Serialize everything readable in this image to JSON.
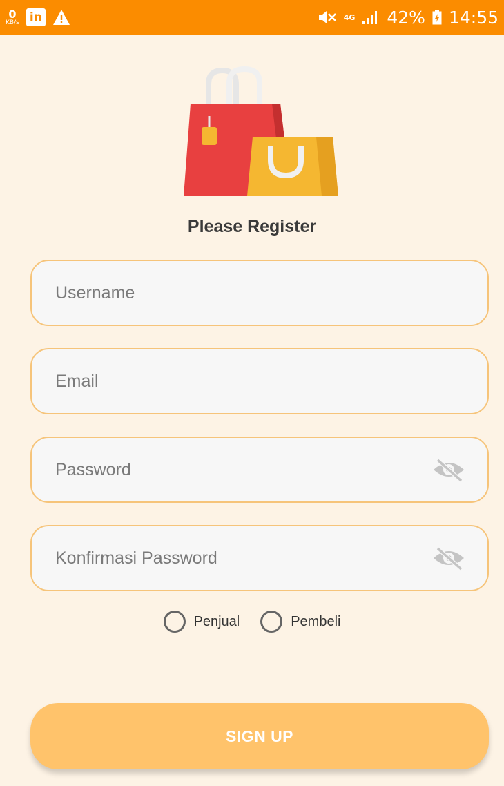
{
  "status_bar": {
    "speed_value": "0",
    "speed_unit": "KB/s",
    "linkedin_badge": "in",
    "network_type": "4G",
    "battery_percent": "42%",
    "time": "14:55",
    "icons": [
      "linkedin-icon",
      "warning-icon",
      "mute-icon",
      "signal-icon",
      "battery-icon"
    ]
  },
  "logo": {
    "icon": "shopping-bags-icon",
    "colors": {
      "red_bag": "#e84040",
      "yellow_bag": "#f5b731",
      "handle": "#f0f0f0"
    }
  },
  "title": "Please Register",
  "fields": {
    "username": {
      "placeholder": "Username",
      "value": ""
    },
    "email": {
      "placeholder": "Email",
      "value": ""
    },
    "password": {
      "placeholder": "Password",
      "value": ""
    },
    "confirm_password": {
      "placeholder": "Konfirmasi Password",
      "value": ""
    }
  },
  "role_options": [
    {
      "label": "Penjual",
      "selected": false
    },
    {
      "label": "Pembeli",
      "selected": false
    }
  ],
  "signup_label": "SIGN UP",
  "colors": {
    "status_bar": "#fb8c00",
    "background": "#fdf3e5",
    "field_border": "#f6c47a",
    "button": "#ffc36b"
  }
}
